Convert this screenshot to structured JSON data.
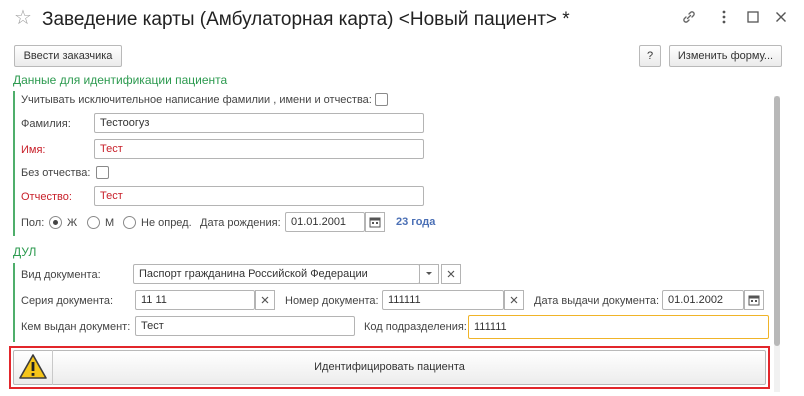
{
  "window": {
    "title": "Заведение карты (Амбулаторная карта) <Новый пациент> *"
  },
  "toolbar": {
    "enter_customer": "Ввести заказчика",
    "help": "?",
    "change_form": "Изменить форму..."
  },
  "identification": {
    "title": "Данные для идентификации пациента",
    "exclusive_spelling_label": "Учитывать исключительное написание фамилии , имени и отчества:",
    "surname_label": "Фамилия:",
    "surname_value": "Тестоогуз",
    "name_label": "Имя:",
    "name_value": "Тест",
    "no_patronymic_label": "Без отчества:",
    "patronymic_label": "Отчество:",
    "patronymic_value": "Тест",
    "gender_label": "Пол:",
    "gender_options": [
      "Ж",
      "М",
      "Не опред."
    ],
    "gender_selected": "Ж",
    "birth_date_label": "Дата рождения:",
    "birth_date_value": "01.01.2001",
    "age": "23 года"
  },
  "document": {
    "title": "ДУЛ",
    "doc_type_label": "Вид документа:",
    "doc_type_value": "Паспорт гражданина Российской Федерации",
    "series_label": "Серия документа:",
    "series_value": "11 11",
    "number_label": "Номер документа:",
    "number_value": "111111",
    "issue_date_label": "Дата выдачи документа:",
    "issue_date_value": "01.01.2002",
    "issued_by_label": "Кем выдан документ:",
    "issued_by_value": "Тест",
    "division_code_label": "Код подразделения:",
    "division_code_value": "111111"
  },
  "action": {
    "identify_label": "Идентифицировать пациента"
  },
  "icons": {
    "favorite": "star-icon",
    "link": "link-icon",
    "menu": "more-icon",
    "restore": "restore-icon",
    "close": "close-icon",
    "calendar": "calendar-icon",
    "clear": "clear-icon",
    "dropdown": "dropdown-icon",
    "warning": "warning-icon"
  },
  "colors": {
    "group_title": "#2c9a4f",
    "required_label": "#c8202a",
    "age_text": "#4a6fb5",
    "highlight_border": "#e2262b",
    "focus_border": "#f0b429"
  }
}
